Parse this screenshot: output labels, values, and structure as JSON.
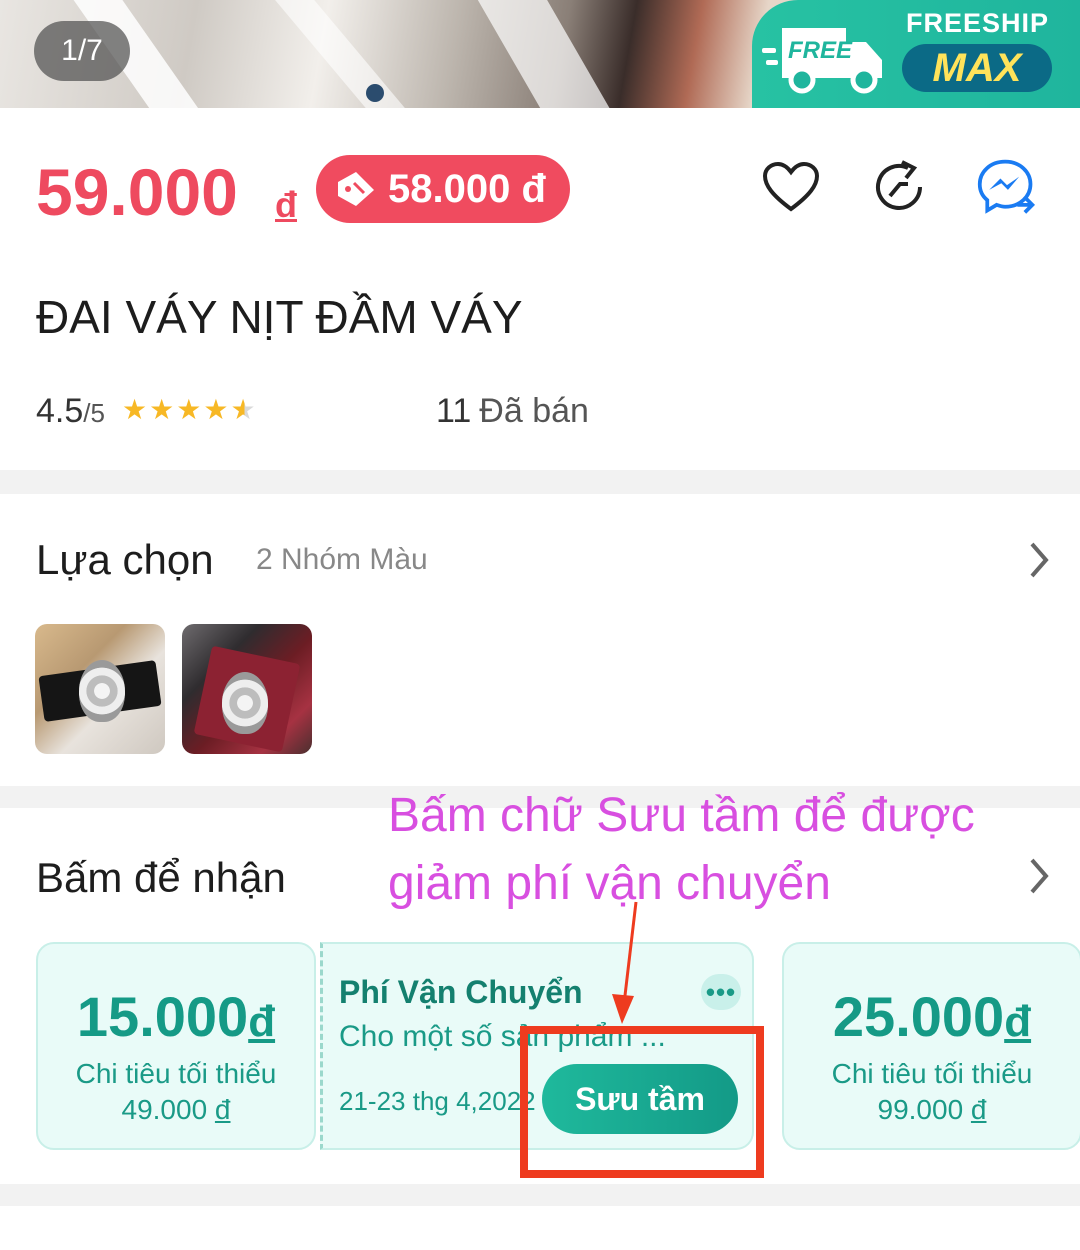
{
  "gallery": {
    "counter": "1/7",
    "freeship_top": "FREESHIP",
    "freeship_free": "FREE",
    "freeship_max": "MAX"
  },
  "price": {
    "current": "59.000",
    "currency": "đ",
    "voucher_price": "58.000 đ"
  },
  "actions": {
    "favorite_icon": "heart-icon",
    "share_icon": "share-icon",
    "chat_icon": "messenger-icon"
  },
  "product": {
    "title": "ĐAI VÁY NỊT ĐẦM VÁY"
  },
  "stats": {
    "rating": "4.5",
    "rating_max": "/5",
    "stars": 4.5,
    "sold_count": "11",
    "sold_label": "Đã bán"
  },
  "options": {
    "title": "Lựa chọn",
    "summary": "2 Nhóm Màu"
  },
  "vouchers": {
    "title": "Bấm để nhận",
    "annotation": "Bấm chữ Sưu tầm để được giảm phí vận chuyển",
    "items": [
      {
        "amount": "15.000",
        "currency": "đ",
        "min_label": "Chi tiêu tối thiểu",
        "min_value": "49.000",
        "min_currency": "đ"
      },
      {
        "title": "Phí Vận Chuyển",
        "desc": "Cho một số sản phẩm ...",
        "date": "21-23 thg 4,2022",
        "more": "•••",
        "button": "Sưu tầm"
      },
      {
        "amount": "25.000",
        "currency": "đ",
        "min_label": "Chi tiêu tối thiểu",
        "min_value": "99.000",
        "min_currency": "đ"
      }
    ]
  },
  "colors": {
    "price_red": "#ee4a5f",
    "brand_teal": "#1fb59d",
    "annotation_magenta": "#d84fe0",
    "highlight_red": "#ee3b1f"
  }
}
